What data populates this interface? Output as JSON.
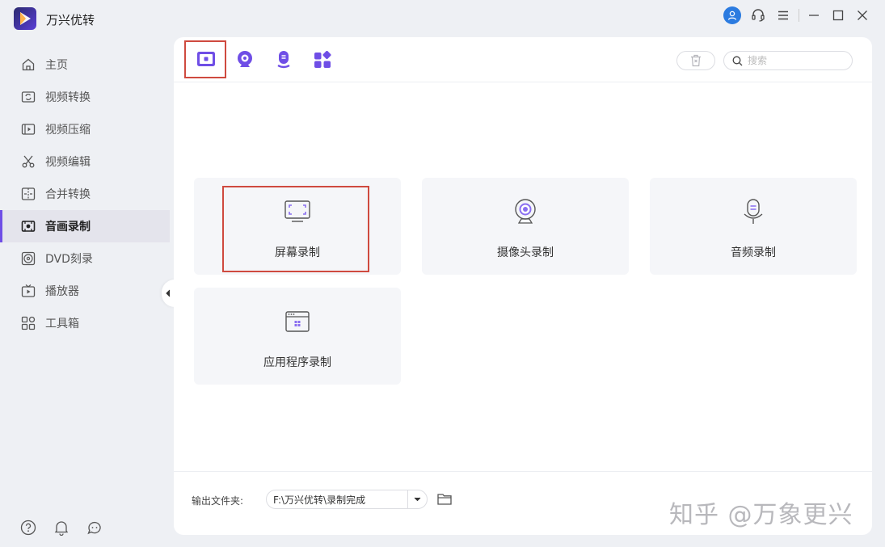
{
  "app": {
    "title": "万兴优转"
  },
  "sidebar": {
    "items": [
      {
        "label": "主页",
        "icon": "home-icon"
      },
      {
        "label": "视频转换",
        "icon": "convert-icon"
      },
      {
        "label": "视频压缩",
        "icon": "compress-icon"
      },
      {
        "label": "视频编辑",
        "icon": "scissors-icon"
      },
      {
        "label": "合并转换",
        "icon": "merge-icon"
      },
      {
        "label": "音画录制",
        "icon": "record-icon",
        "active": true
      },
      {
        "label": "DVD刻录",
        "icon": "disc-icon"
      },
      {
        "label": "播放器",
        "icon": "tv-icon"
      },
      {
        "label": "工具箱",
        "icon": "grid-icon"
      }
    ]
  },
  "toolbar": {
    "search_placeholder": "搜索"
  },
  "cards": {
    "screen": "屏幕录制",
    "webcam": "摄像头录制",
    "audio": "音频录制",
    "app": "应用程序录制"
  },
  "footer": {
    "output_label": "输出文件夹:",
    "output_path": "F:\\万兴优转\\录制完成"
  },
  "watermark": "知乎 @万象更兴",
  "colors": {
    "accent": "#6f4ee6",
    "highlight_box": "#cf4a3f",
    "background": "#eef0f4"
  }
}
